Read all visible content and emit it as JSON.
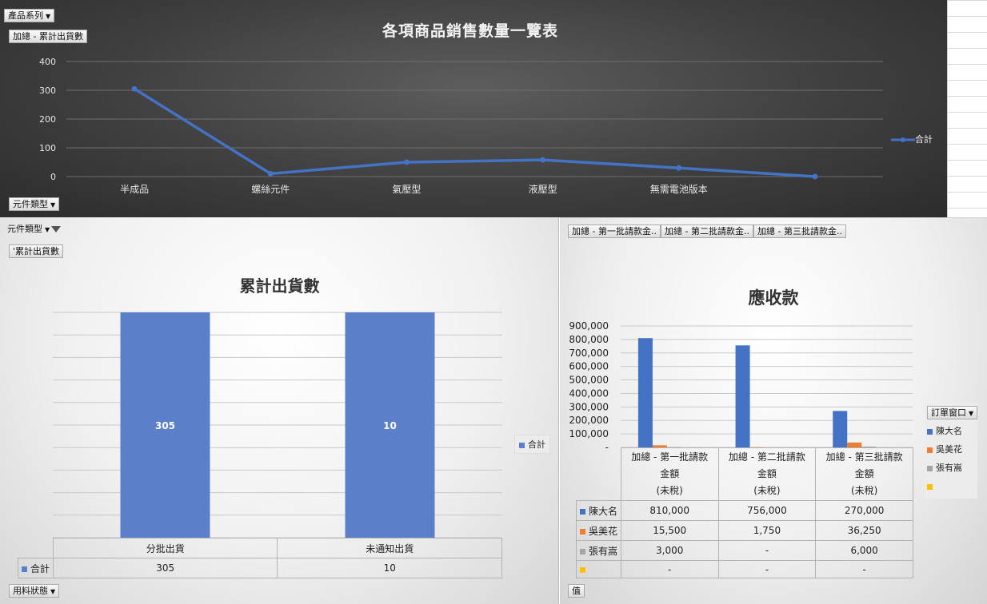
{
  "top_chart": {
    "filter_product_series": "產品系列",
    "value_field_button": "加總 - 累計出貨數",
    "axis_field_button": "元件類型",
    "chart_data": {
      "type": "line",
      "title": "各項商品銷售數量一覽表",
      "categories": [
        "半成品",
        "螺絲元件",
        "氣壓型",
        "液壓型",
        "無需電池版本",
        ""
      ],
      "series": [
        {
          "name": "合計",
          "values": [
            305,
            10,
            50,
            58,
            30,
            0
          ],
          "color": "#4472c4"
        }
      ],
      "y_ticks": [
        0,
        100,
        200,
        300,
        400
      ],
      "ylim": [
        0,
        400
      ],
      "grid": true,
      "legend": "right"
    }
  },
  "left_chart": {
    "filter_button": "元件類型",
    "value_field_button": "'累計出貨數",
    "bottom_field_button": "用料狀態",
    "legend_label": "合計",
    "chart_data": {
      "type": "bar",
      "title": "累計出貨數",
      "categories": [
        "分批出貨",
        "未通知出貨"
      ],
      "series": [
        {
          "name": "合計",
          "values": [
            305,
            10
          ],
          "labels": [
            "305",
            "10"
          ],
          "color": "#5b7fc9"
        }
      ],
      "grid": true,
      "legend": "right",
      "data_table": true
    }
  },
  "right_chart": {
    "field_buttons": [
      "加總 - 第一批請款金..",
      "加總 - 第二批請款金..",
      "加總 - 第三批請款金.."
    ],
    "legend_field_button": "訂單窗口",
    "bottom_field_button": "值",
    "chart_data": {
      "type": "bar",
      "title": "應收款",
      "categories": [
        [
          "加總 - 第一批請款",
          "金額",
          "(未稅)"
        ],
        [
          "加總 - 第二批請款",
          "金額",
          "(未稅)"
        ],
        [
          "加總 - 第三批請款",
          "金額",
          "(未稅)"
        ]
      ],
      "y_ticks": [
        "-",
        "100,000",
        "200,000",
        "300,000",
        "400,000",
        "500,000",
        "600,000",
        "700,000",
        "800,000",
        "900,000"
      ],
      "ylim": [
        0,
        900000
      ],
      "series": [
        {
          "name": "陳大名",
          "values": [
            810000,
            756000,
            270000
          ],
          "labels": [
            "810,000",
            "756,000",
            "270,000"
          ],
          "color": "#4472c4"
        },
        {
          "name": "吳美花",
          "values": [
            15500,
            1750,
            36250
          ],
          "labels": [
            "15,500",
            "1,750",
            "36,250"
          ],
          "color": "#ed7d31"
        },
        {
          "name": "張有嵩",
          "values": [
            3000,
            0,
            6000
          ],
          "labels": [
            "3,000",
            "-",
            "6,000"
          ],
          "color": "#a5a5a5"
        },
        {
          "name": "",
          "values": [
            0,
            0,
            0
          ],
          "labels": [
            "-",
            "-",
            "-"
          ],
          "color": "#ffc000"
        }
      ],
      "grid": true,
      "legend": "right",
      "data_table": true
    }
  }
}
